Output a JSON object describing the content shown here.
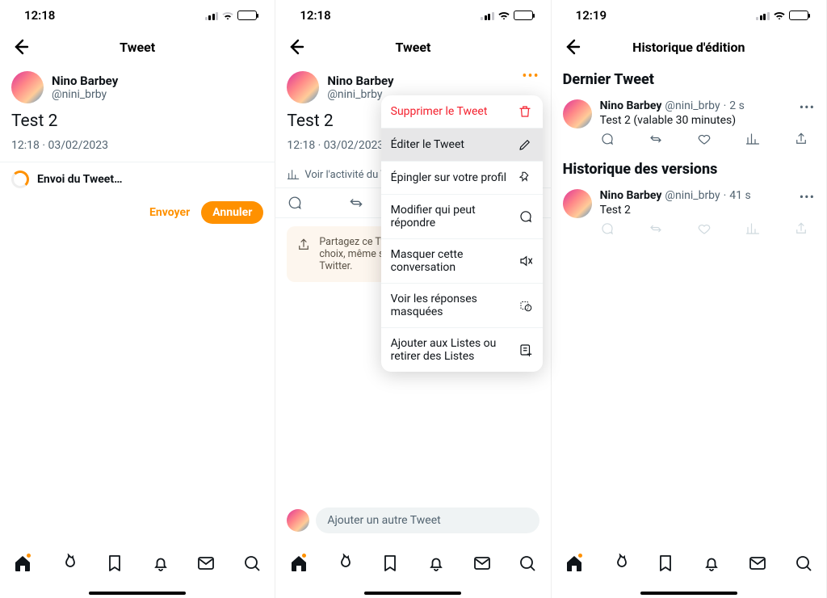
{
  "screen1": {
    "status_time": "12:18",
    "header_title": "Tweet",
    "user_name": "Nino Barbey",
    "user_handle": "@nini_brby",
    "tweet_text": "Test 2",
    "timestamp": "12:18 · 03/02/2023",
    "sending_label": "Envoi du Tweet…",
    "send_btn": "Envoyer",
    "cancel_btn": "Annuler"
  },
  "screen2": {
    "status_time": "12:18",
    "header_title": "Tweet",
    "user_name": "Nino Barbey",
    "user_handle": "@nini_brby",
    "tweet_text": "Test 2",
    "timestamp": "12:18 · 03/02/2023",
    "activity_label": "Voir l'activité du Tw",
    "menu": {
      "delete": "Supprimer le Tweet",
      "edit": "Éditer le Tweet",
      "pin": "Épingler sur votre profil",
      "who_reply": "Modifier qui peut répondre",
      "hide_conv": "Masquer cette conversation",
      "show_hidden": "Voir les réponses masquées",
      "lists": "Ajouter aux Listes ou retirer des Listes"
    },
    "notice_text": "Partagez ce Tweet avec la personne de votre choix, même si elle n'est pas sur Twitter.",
    "notice_text_visible": "Partagez ce Tw\n choix, même si\nTwitter.",
    "compose_placeholder": "Ajouter un autre Tweet"
  },
  "screen3": {
    "status_time": "12:19",
    "header_title": "Historique d'édition",
    "section_latest": "Dernier Tweet",
    "section_versions": "Historique des versions",
    "latest": {
      "user_name": "Nino Barbey",
      "user_handle": "@nini_brby",
      "time": "2 s",
      "body": "Test 2 (valable 30 minutes)"
    },
    "version1": {
      "user_name": "Nino Barbey",
      "user_handle": "@nini_brby",
      "time": "41 s",
      "body": "Test 2"
    }
  }
}
